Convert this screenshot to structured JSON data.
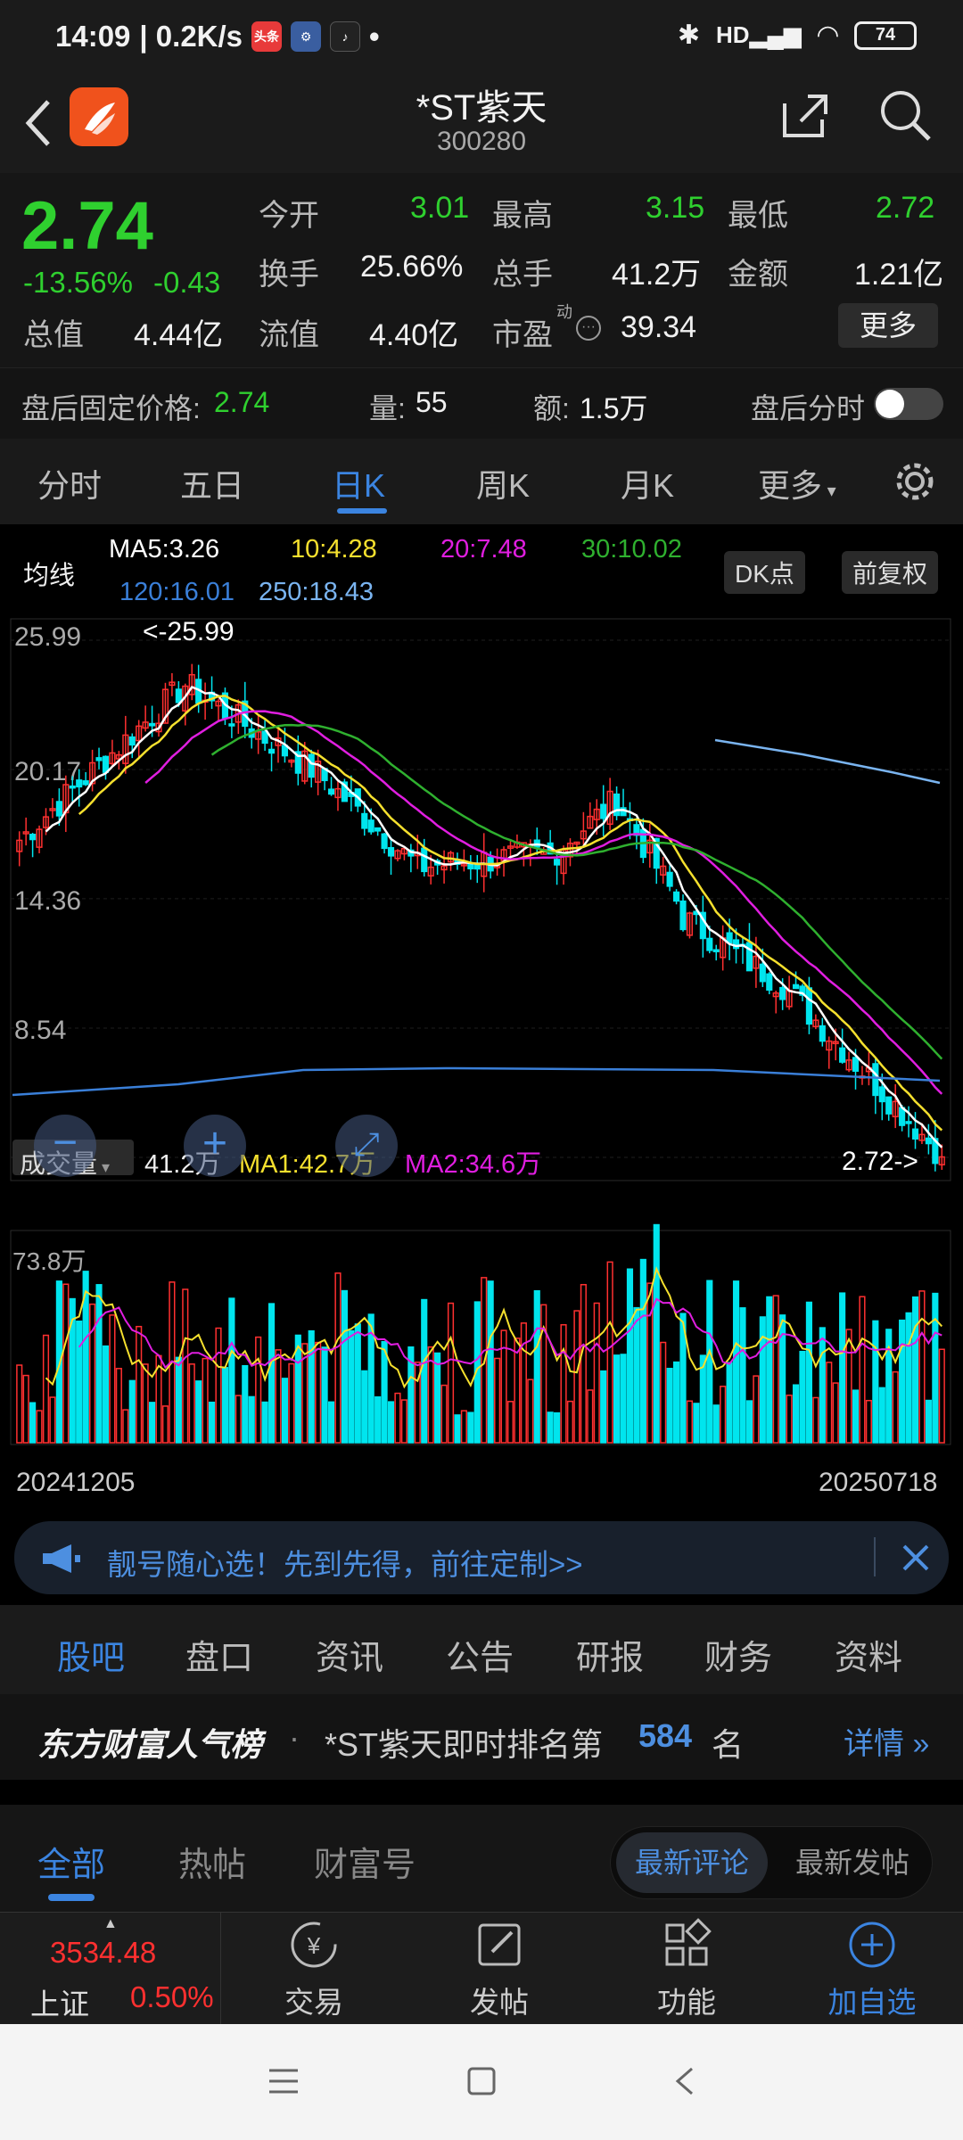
{
  "status": {
    "time": "14:09",
    "net": "| 0.2K/s",
    "battery": "74"
  },
  "header": {
    "title": "*ST紫天",
    "code": "300280"
  },
  "quote": {
    "price": "2.74",
    "pct": "-13.56%",
    "chg": "-0.43",
    "open_label": "今开",
    "open": "3.01",
    "high_label": "最高",
    "high": "3.15",
    "low_label": "最低",
    "low": "2.72",
    "turnover_label": "换手",
    "turnover": "25.66%",
    "vol_label": "总手",
    "vol": "41.2万",
    "amount_label": "金额",
    "amount": "1.21亿",
    "mcap_label": "总值",
    "mcap": "4.44亿",
    "float_label": "流值",
    "float": "4.40亿",
    "pe_label": "市盈",
    "pe_sup": "动",
    "pe": "39.34",
    "more": "更多"
  },
  "after_hours": {
    "price_label": "盘后固定价格:",
    "price": "2.74",
    "vol_label": "量:",
    "vol": "55",
    "amt_label": "额:",
    "amt": "1.5万",
    "intraday": "盘后分时"
  },
  "tabs": [
    "分时",
    "五日",
    "日K",
    "周K",
    "月K",
    "更多"
  ],
  "ma": {
    "label": "均线",
    "ma5": "MA5:3.26",
    "ma10": "10:4.28",
    "ma20": "20:7.48",
    "ma30": "30:10.02",
    "ma120": "120:16.01",
    "ma250": "250:18.43",
    "dk": "DK点",
    "fq": "前复权"
  },
  "price_axis": [
    "25.99",
    "20.17",
    "14.36",
    "8.54",
    "2.72"
  ],
  "hi_marker": "<-25.99",
  "lo_marker": "2.72->",
  "volume": {
    "label": "成交量",
    "value": "41.2万",
    "ma1": "MA1:42.7万",
    "ma2": "MA2:34.6万",
    "max": "73.8万",
    "start_date": "20241205",
    "end_date": "20250718"
  },
  "colors": {
    "up": "#ff3030",
    "down": "#00e5ee",
    "ma5": "#ffffff",
    "ma10": "#f5e02e",
    "ma20": "#e01ee0",
    "ma30": "#2fb02f",
    "ma120": "#3a7fd8",
    "ma250": "#7ab4f0",
    "accent": "#3b84e0"
  },
  "banner": "靓号随心选！先到先得，前往定制>>",
  "sections": [
    "股吧",
    "盘口",
    "资讯",
    "公告",
    "研报",
    "财务",
    "资料"
  ],
  "rank": {
    "brand": "东方财富人气榜",
    "text": "*ST紫天即时排名第",
    "num": "584",
    "unit": "名",
    "detail": "详情"
  },
  "forum_tabs": [
    "全部",
    "热帖",
    "财富号"
  ],
  "sort_tabs": [
    "最新评论",
    "最新发帖"
  ],
  "bottom": {
    "index_value": "3534.48",
    "index_name": "上证",
    "index_pct": "0.50%",
    "trade": "交易",
    "post": "发帖",
    "func": "功能",
    "add": "加自选"
  }
}
